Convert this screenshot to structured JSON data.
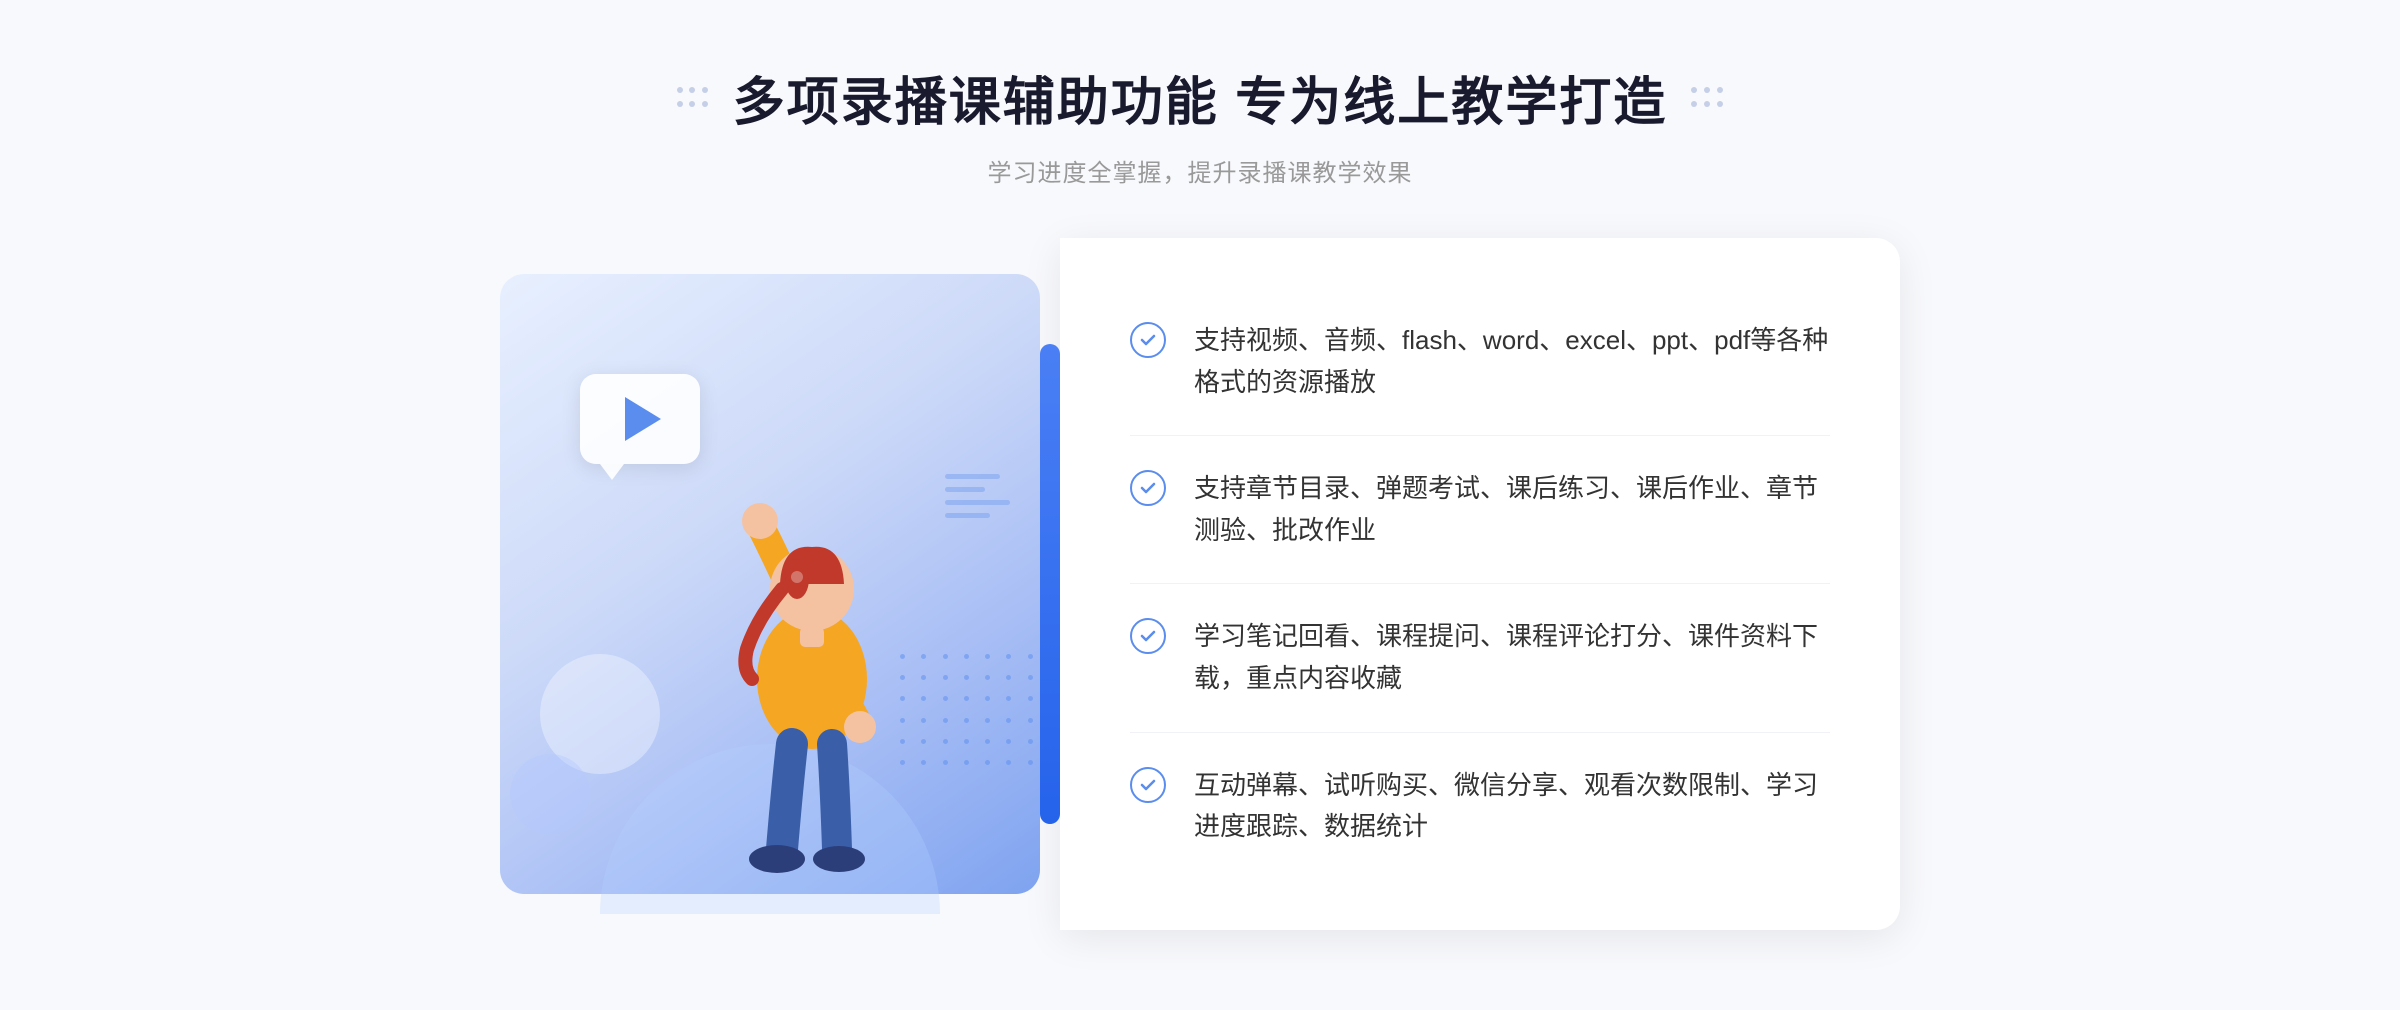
{
  "page": {
    "background_color": "#f8f9fc"
  },
  "header": {
    "title": "多项录播课辅助功能 专为线上教学打造",
    "subtitle": "学习进度全掌握，提升录播课教学效果",
    "title_deco_left": "decoration-dots-left",
    "title_deco_right": "decoration-dots-right"
  },
  "features": [
    {
      "id": 1,
      "text": "支持视频、音频、flash、word、excel、ppt、pdf等各种格式的资源播放"
    },
    {
      "id": 2,
      "text": "支持章节目录、弹题考试、课后练习、课后作业、章节测验、批改作业"
    },
    {
      "id": 3,
      "text": "学习笔记回看、课程提问、课程评论打分、课件资料下载，重点内容收藏"
    },
    {
      "id": 4,
      "text": "互动弹幕、试听购买、微信分享、观看次数限制、学习进度跟踪、数据统计"
    }
  ],
  "illustration": {
    "play_button_alt": "play button",
    "card_bg_gradient": "linear-gradient(145deg, #e8f0ff, #7fa3f0)"
  },
  "navigation": {
    "left_arrow": "«"
  }
}
